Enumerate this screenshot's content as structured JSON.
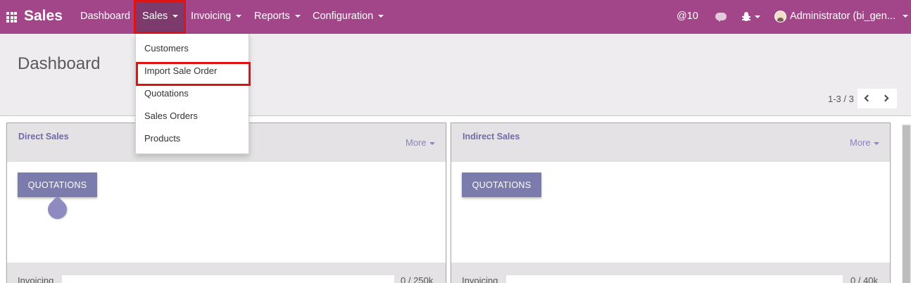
{
  "navbar": {
    "brand": "Sales",
    "items": [
      {
        "label": "Dashboard"
      },
      {
        "label": "Sales"
      },
      {
        "label": "Invoicing"
      },
      {
        "label": "Reports"
      },
      {
        "label": "Configuration"
      }
    ],
    "notifications_count": "@10",
    "user_name": "Administrator (bi_gen...",
    "accent_color": "#a24689",
    "icons": [
      "apps-grid-icon",
      "chat-bubbles-icon",
      "bug-icon",
      "user-avatar"
    ]
  },
  "sales_menu": {
    "items": [
      {
        "label": "Customers"
      },
      {
        "label": "Import Sale Order"
      },
      {
        "label": "Quotations"
      },
      {
        "label": "Sales Orders"
      },
      {
        "label": "Products"
      }
    ],
    "highlighted_item": "Import Sale Order",
    "highlight_color": "#e01313"
  },
  "control_panel": {
    "title": "Dashboard",
    "pager_value": "1-3 / 3"
  },
  "teams": [
    {
      "name": "Direct Sales",
      "more_label": "More",
      "action_label": "QUOTATIONS",
      "footer_label": "Invoicing",
      "footer_value": "0 / 250k"
    },
    {
      "name": "Indirect Sales",
      "more_label": "More",
      "action_label": "QUOTATIONS",
      "footer_label": "Invoicing",
      "footer_value": "0 / 40k"
    }
  ]
}
